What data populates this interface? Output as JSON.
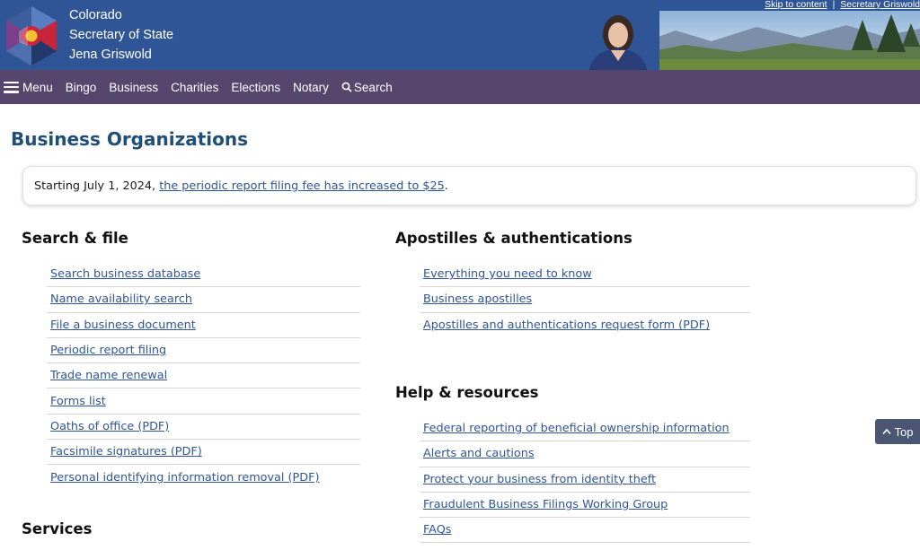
{
  "header": {
    "agency_lines": [
      "Colorado",
      "Secretary of State",
      "Jena Griswold"
    ],
    "skip_link": "Skip to content",
    "separator": "|",
    "secretary_link": "Secretary Griswold",
    "banner_icon": "portrait-landscape-banner",
    "logo_icon": "colorado-hexagon-logo"
  },
  "nav": {
    "menu": "Menu",
    "items": [
      "Bingo",
      "Business",
      "Charities",
      "Elections",
      "Notary"
    ],
    "search": "Search"
  },
  "page": {
    "title": "Business Organizations"
  },
  "notice": {
    "prefix": "Starting July 1, 2024, ",
    "link": "the periodic report filing fee has increased to $25",
    "suffix": "."
  },
  "sections": {
    "search_file": {
      "title": "Search & file",
      "links": [
        "Search business database",
        "Name availability search",
        "File a business document",
        "Periodic report filing",
        "Trade name renewal",
        "Forms list",
        "Oaths of office (PDF)",
        "Facsimile signatures (PDF)",
        "Personal identifying information removal (PDF)"
      ]
    },
    "apostilles": {
      "title": "Apostilles & authentications",
      "links": [
        "Everything you need to know",
        "Business apostilles",
        "Apostilles and authentications request form (PDF)"
      ]
    },
    "help": {
      "title": "Help & resources",
      "links": [
        "Federal reporting of beneficial ownership information",
        "Alerts and cautions",
        "Protect your business from identity theft",
        "Fraudulent Business Filings Working Group",
        "FAQs"
      ]
    },
    "services": {
      "title": "Services"
    }
  },
  "top_button": "Top",
  "colors": {
    "header_blue": "#2f5597",
    "nav_purple": "#56466e",
    "title_blue": "#1f4e79",
    "link_blue": "#2f5597"
  }
}
